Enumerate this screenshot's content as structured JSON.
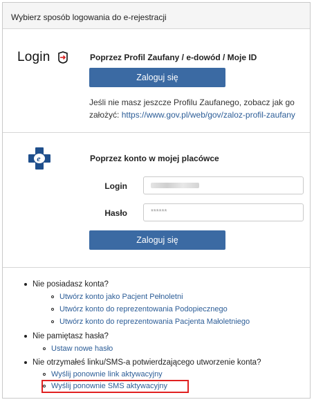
{
  "header": {
    "title": "Wybierz sposób logowania do e-rejestracji"
  },
  "profile_login": {
    "logo_text": "Login",
    "logo_icon": "login-arrow-icon",
    "title": "Poprzez Profil Zaufany / e-dowód / Moje ID",
    "button_label": "Zaloguj się",
    "info_text": "Jeśli nie masz jeszcze Profilu Zaufanego, zobacz jak go założyć:",
    "info_link": "https://www.gov.pl/web/gov/zaloz-profil-zaufany"
  },
  "clinic_login": {
    "logo_icon": "clinic-e-cross-icon",
    "title": "Poprzez konto w mojej placówce",
    "login_label": "Login",
    "login_value": "",
    "password_label": "Hasło",
    "password_value": "******",
    "button_label": "Zaloguj się"
  },
  "links": {
    "no_account": "Nie posiadasz konta?",
    "create_adult": "Utwórz konto jako Pacjent Pełnoletni",
    "create_ward": "Utwórz konto do reprezentowania Podopiecznego",
    "create_minor": "Utwórz konto do reprezentowania Pacjenta Małoletniego",
    "forgot_password": "Nie pamiętasz hasła?",
    "set_new_password": "Ustaw nowe hasło",
    "no_confirmation": "Nie otrzymałeś linku/SMS-a potwierdzającego utworzenie konta?",
    "resend_link": "Wyślij ponownie link aktywacyjny",
    "resend_sms": "Wyślij ponownie SMS aktywacyjny"
  },
  "colors": {
    "primary_button": "#3b6aa3",
    "link": "#2c5d97",
    "highlight": "#e02020",
    "header_bg": "#f5f5f5"
  }
}
